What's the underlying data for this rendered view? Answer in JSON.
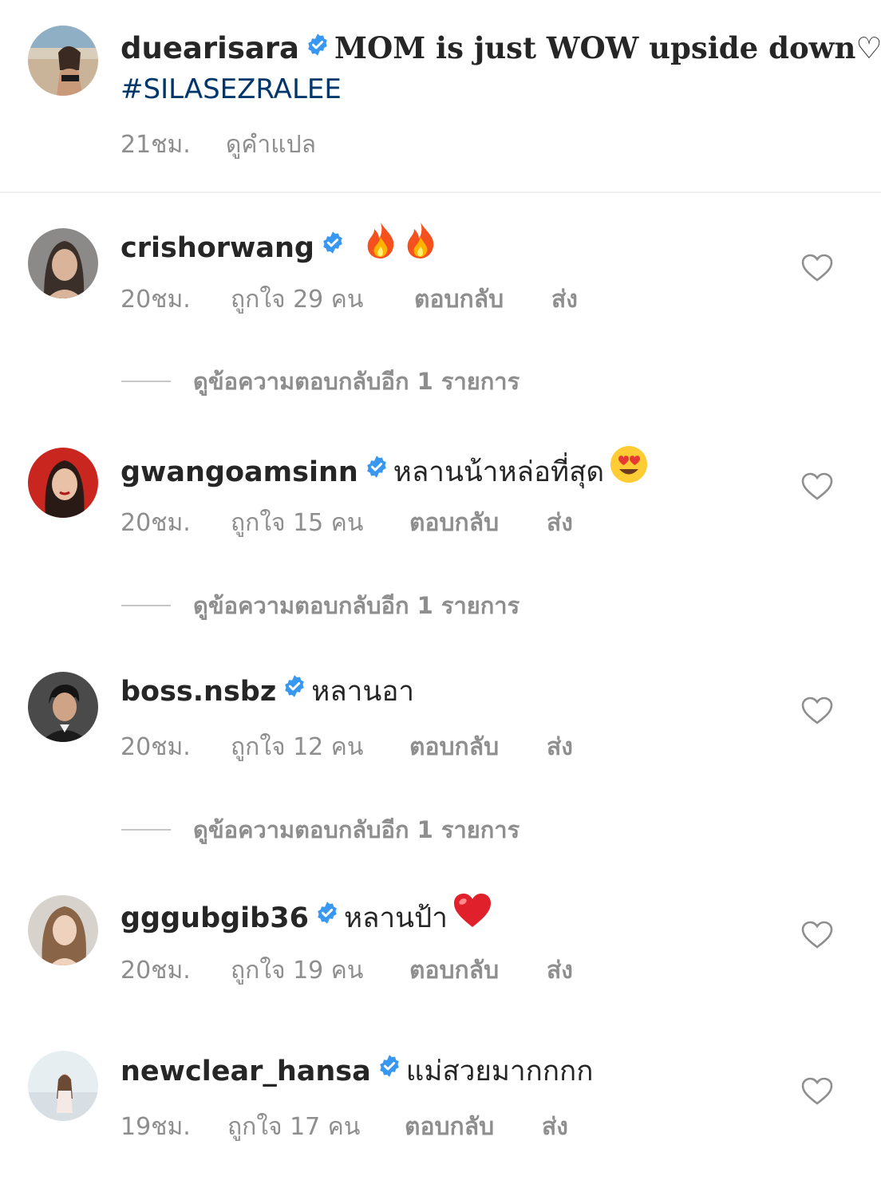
{
  "caption": {
    "username": "duearisara",
    "text": "MOM is just WOW upside down♡",
    "hashtag": "#SILASEZRALEE",
    "time": "21ชม.",
    "translate": "ดูคำแปล"
  },
  "comments": [
    {
      "username": "crishorwang",
      "text": "",
      "emoji": [
        "fire-icon",
        "fire-icon"
      ],
      "time": "20ชม.",
      "likes": "ถูกใจ 29 คน",
      "reply": "ตอบกลับ",
      "send": "ส่ง",
      "view_replies": "ดูข้อความตอบกลับอีก 1 รายการ"
    },
    {
      "username": "gwangoamsinn",
      "text": "หลานน้าหล่อที่สุด",
      "emoji": [
        "heart-eyes-icon"
      ],
      "time": "20ชม.",
      "likes": "ถูกใจ 15 คน",
      "reply": "ตอบกลับ",
      "send": "ส่ง",
      "view_replies": "ดูข้อความตอบกลับอีก 1 รายการ"
    },
    {
      "username": "boss.nsbz",
      "text": "หลานอา",
      "emoji": [],
      "time": "20ชม.",
      "likes": "ถูกใจ 12 คน",
      "reply": "ตอบกลับ",
      "send": "ส่ง",
      "view_replies": "ดูข้อความตอบกลับอีก 1 รายการ"
    },
    {
      "username": "gggubgib36",
      "text": "หลานป้า",
      "emoji": [
        "red-heart-icon"
      ],
      "time": "20ชม.",
      "likes": "ถูกใจ 19 คน",
      "reply": "ตอบกลับ",
      "send": "ส่ง"
    },
    {
      "username": "newclear_hansa",
      "text": "แม่สวยมากกกก",
      "emoji": [],
      "time": "19ชม.",
      "likes": "ถูกใจ 17 คน",
      "reply": "ตอบกลับ",
      "send": "ส่ง"
    }
  ],
  "colors": {
    "verified": "#3897f0",
    "meta": "#8e8e8e",
    "hashtag": "#00376b",
    "text": "#262626"
  }
}
